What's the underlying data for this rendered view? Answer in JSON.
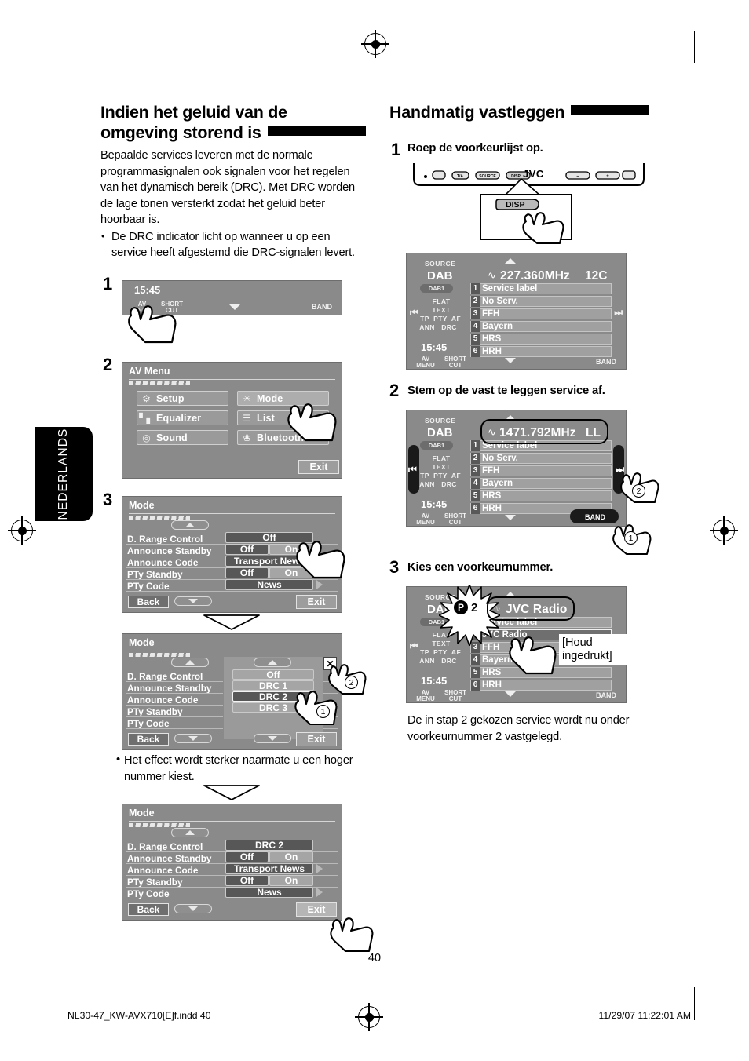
{
  "page": {
    "number": "40",
    "language_tab": "NEDERLANDS",
    "footer_left": "NL30-47_KW-AVX710[E]f.indd   40",
    "footer_right": "11/29/07   11:22:01 AM"
  },
  "left": {
    "heading": "Indien het geluid van de omgeving storend is",
    "intro": "Bepaalde services leveren met de normale programmasignalen ook signalen voor het regelen van het dynamisch bereik (DRC). Met DRC worden de lage tonen versterkt zodat het geluid beter hoorbaar is.",
    "bullet": "De DRC indicator licht op wanneer u op een service heeft afgestemd die DRC-signalen levert.",
    "steps": {
      "s1": "1",
      "s2": "2",
      "s3": "3"
    },
    "note": "Het effect wordt sterker naarmate u een hoger nummer kiest.",
    "screen1": {
      "time": "15:45",
      "av_menu": "AV\nMENU",
      "av_menu_l1": "AV",
      "av_menu_l2": "MENU",
      "shortcut_l1": "SHORT",
      "shortcut_l2": "CUT",
      "band": "BAND"
    },
    "av_menu": {
      "title": "AV Menu",
      "items": [
        {
          "label": "Setup",
          "icon": "gear-icon"
        },
        {
          "label": "Mode",
          "icon": "sun-mode-icon"
        },
        {
          "label": "Equalizer",
          "icon": "equalizer-icon"
        },
        {
          "label": "List",
          "icon": "list-icon"
        },
        {
          "label": "Sound",
          "icon": "speaker-icon"
        },
        {
          "label": "Bluetooth",
          "icon": "bluetooth-icon"
        }
      ],
      "exit": "Exit"
    },
    "mode_a": {
      "title": "Mode",
      "rows": [
        {
          "label": "D. Range Control",
          "values": [
            "Off"
          ],
          "selected": 0,
          "wide": true
        },
        {
          "label": "Announce Standby",
          "values": [
            "Off",
            "On"
          ],
          "selected": 0
        },
        {
          "label": "Announce Code",
          "values": [
            "Transport News"
          ],
          "selected": 0,
          "wide": true
        },
        {
          "label": "PTy Standby",
          "values": [
            "Off",
            "On"
          ],
          "selected": 0
        },
        {
          "label": "PTy Code",
          "values": [
            "News"
          ],
          "selected": 0,
          "wide": true,
          "arrow": true
        }
      ],
      "back": "Back",
      "exit": "Exit"
    },
    "mode_b": {
      "title": "Mode",
      "rows": [
        {
          "label": "D. Range Control"
        },
        {
          "label": "Announce Standby"
        },
        {
          "label": "Announce Code"
        },
        {
          "label": "PTy Standby"
        },
        {
          "label": "PTy Code"
        }
      ],
      "popup_options": [
        "Off",
        "DRC 1",
        "DRC 2",
        "DRC 3"
      ],
      "popup_selected": 2,
      "close_icon": "close-icon",
      "marker_1": "1",
      "marker_2": "2",
      "back": "Back",
      "exit": "Exit"
    },
    "mode_c": {
      "title": "Mode",
      "rows": [
        {
          "label": "D. Range Control",
          "values": [
            "DRC 2"
          ],
          "selected": 0,
          "wide": true
        },
        {
          "label": "Announce Standby",
          "values": [
            "Off",
            "On"
          ],
          "selected": 0
        },
        {
          "label": "Announce Code",
          "values": [
            "Transport News"
          ],
          "selected": 0,
          "wide": true,
          "arrow": true
        },
        {
          "label": "PTy Standby",
          "values": [
            "Off",
            "On"
          ],
          "selected": 0
        },
        {
          "label": "PTy Code",
          "values": [
            "News"
          ],
          "selected": 0,
          "wide": true,
          "arrow": true
        }
      ],
      "back": "Back",
      "exit": "Exit"
    }
  },
  "right": {
    "heading": "Handmatig vastleggen",
    "step1": {
      "num": "1",
      "title": "Roep de voorkeurlijst op."
    },
    "step2": {
      "num": "2",
      "title": "Stem op de vast te leggen service af."
    },
    "step3": {
      "num": "3",
      "title": "Kies een voorkeurnummer."
    },
    "faceplate": {
      "brand": "JVC",
      "disp": "DISP",
      "callout_disp": "DISP"
    },
    "result": "De in stap 2 gekozen service wordt nu onder voorkeurnummer 2 vastgelegd.",
    "radio1": {
      "source": "SOURCE",
      "band_name": "DAB",
      "sub_band": "DAB1",
      "ind_flat": "FLAT",
      "ind_text": "TEXT",
      "ind_tp": "TP",
      "ind_pty": "PTY",
      "ind_af": "AF",
      "ind_ann": "ANN",
      "ind_drc": "DRC",
      "time": "15:45",
      "freq": "227.360MHz",
      "channel": "12C",
      "presets": [
        "Service label",
        "No Serv.",
        "FFH",
        "Bayern",
        "HRS",
        "HRH"
      ],
      "av_menu_l1": "AV",
      "av_menu_l2": "MENU",
      "shortcut_l1": "SHORT",
      "shortcut_l2": "CUT",
      "band": "BAND"
    },
    "radio2": {
      "source": "SOURCE",
      "band_name": "DAB",
      "sub_band": "DAB1",
      "time": "15:45",
      "freq": "1471.792MHz",
      "channel": "LL",
      "presets": [
        "Service label",
        "No Serv.",
        "FFH",
        "Bayern",
        "HRS",
        "HRH"
      ],
      "av_menu_l1": "AV",
      "av_menu_l2": "MENU",
      "shortcut_l1": "SHORT",
      "shortcut_l2": "CUT",
      "band": "BAND",
      "marker_1": "1",
      "marker_2": "2"
    },
    "radio3": {
      "source": "SOURCE",
      "band_name": "DAB",
      "sub_band": "DAB1",
      "time": "15:45",
      "preset_badge": "P 2",
      "title_bar": "JVC Radio",
      "presets": [
        "Service label",
        "JVC Radio",
        "FFH",
        "Bayern",
        "HRS",
        "HRH"
      ],
      "selected_preset": 1,
      "hold_note_l1": "[Houd",
      "hold_note_l2": "ingedrukt]",
      "av_menu_l1": "AV",
      "av_menu_l2": "MENU",
      "shortcut_l1": "SHORT",
      "shortcut_l2": "CUT",
      "band": "BAND"
    }
  },
  "colors": {
    "lcd_bg": "#8a8a8a",
    "lcd_btn_light": "#a5a5a5",
    "lcd_btn_dark": "#575757",
    "text": "#000000"
  }
}
